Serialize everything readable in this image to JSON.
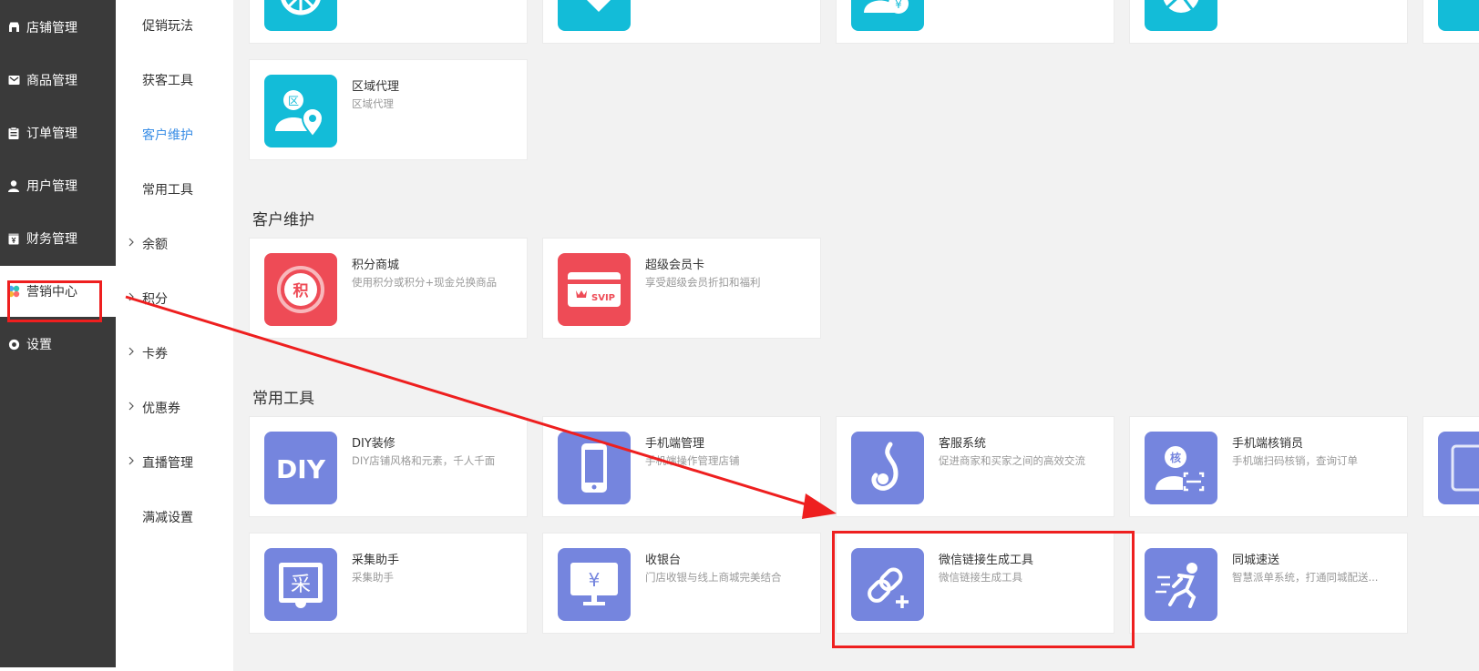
{
  "colors": {
    "sidebar_bg": "#3a3a3a",
    "active_link": "#3a8ee6",
    "cyan_icon": "#13bcd8",
    "red_icon": "#ee4b56",
    "purple_icon": "#7585de",
    "annotation_red": "#ee1f1f"
  },
  "primary_nav": [
    {
      "label": "店铺管理",
      "icon": "store-icon"
    },
    {
      "label": "商品管理",
      "icon": "goods-icon"
    },
    {
      "label": "订单管理",
      "icon": "order-icon"
    },
    {
      "label": "用户管理",
      "icon": "user-icon"
    },
    {
      "label": "财务管理",
      "icon": "finance-icon"
    },
    {
      "label": "营销中心",
      "icon": "marketing-icon",
      "active": true
    },
    {
      "label": "设置",
      "icon": "settings-icon"
    }
  ],
  "secondary_nav": [
    {
      "label": "促销玩法"
    },
    {
      "label": "获客工具"
    },
    {
      "label": "客户维护",
      "active": true
    },
    {
      "label": "常用工具"
    },
    {
      "label": "余额",
      "expandable": true
    },
    {
      "label": "积分",
      "expandable": true
    },
    {
      "label": "卡券",
      "expandable": true
    },
    {
      "label": "优惠券",
      "expandable": true
    },
    {
      "label": "直播管理",
      "expandable": true
    },
    {
      "label": "满减设置"
    }
  ],
  "region_card": {
    "title": "区域代理",
    "desc": "区域代理",
    "icon": "region-agent-icon"
  },
  "sections": {
    "customer": {
      "title": "客户维护",
      "cards": [
        {
          "title": "积分商城",
          "desc": "使用积分或积分+现金兑换商品",
          "icon": "points-mall-icon",
          "icon_text": "积"
        },
        {
          "title": "超级会员卡",
          "desc": "享受超级会员折扣和福利",
          "icon": "svip-card-icon",
          "icon_text": "SVIP"
        }
      ]
    },
    "tools": {
      "title": "常用工具",
      "cards": [
        {
          "title": "DIY装修",
          "desc": "DIY店铺风格和元素，千人千面",
          "icon": "diy-icon",
          "icon_text": "DIY"
        },
        {
          "title": "手机端管理",
          "desc": "手机端操作管理店铺",
          "icon": "mobile-icon"
        },
        {
          "title": "客服系统",
          "desc": "促进商家和买家之间的高效交流",
          "icon": "customer-service-icon"
        },
        {
          "title": "手机端核销员",
          "desc": "手机端扫码核销，查询订单",
          "icon": "verifier-icon",
          "icon_text": "核"
        },
        {
          "title": "采集助手",
          "desc": "采集助手",
          "icon": "collect-icon",
          "icon_text": "采"
        },
        {
          "title": "收银台",
          "desc": "门店收银与线上商城完美结合",
          "icon": "cashier-icon",
          "icon_text": "¥"
        },
        {
          "title": "微信链接生成工具",
          "desc": "微信链接生成工具",
          "icon": "link-icon"
        },
        {
          "title": "同城速送",
          "desc": "智慧派单系统，打通同城配送...",
          "icon": "delivery-icon"
        }
      ]
    }
  }
}
